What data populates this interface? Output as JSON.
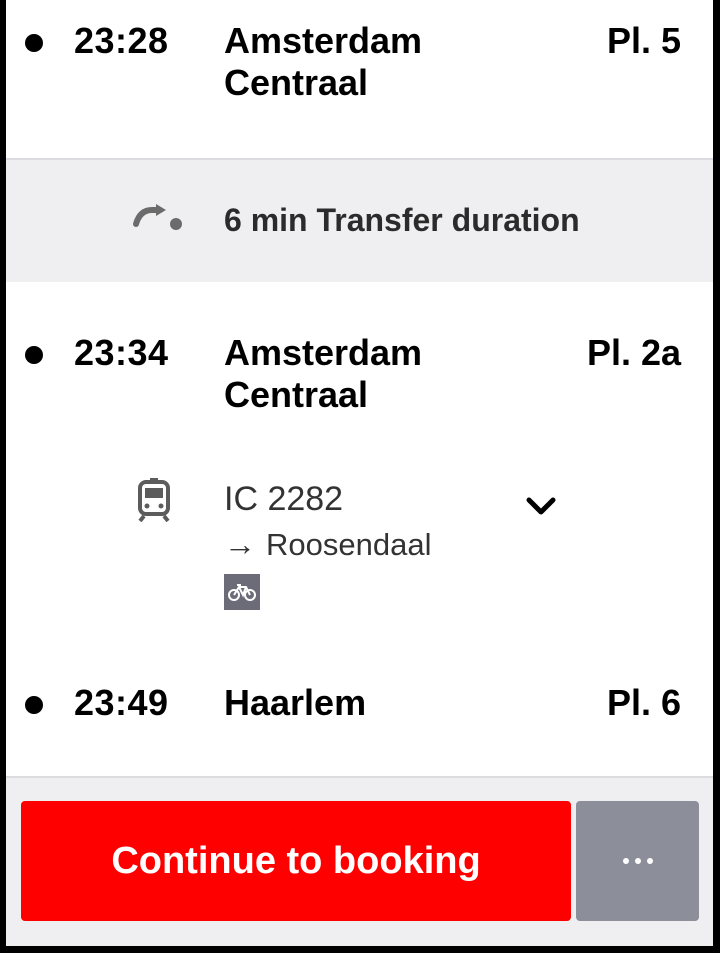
{
  "stops": [
    {
      "time": "23:28",
      "station": "Amsterdam Centraal",
      "platform": "Pl. 5"
    },
    {
      "time": "23:34",
      "station": "Amsterdam Centraal",
      "platform": "Pl. 2a"
    },
    {
      "time": "23:49",
      "station": "Haarlem",
      "platform": "Pl. 6"
    }
  ],
  "transfer": {
    "text": "6 min Transfer duration",
    "icon": "transfer-walk-icon"
  },
  "leg": {
    "train": "IC 2282",
    "direction": "Roosendaal",
    "icons": [
      "train-icon",
      "arrow-right-icon",
      "bicycle-icon",
      "chevron-down-icon"
    ]
  },
  "footer": {
    "continue_label": "Continue to booking",
    "more_icon": "more-options-icon"
  },
  "colors": {
    "primary_button": "#ff0000",
    "secondary_button": "#8c8f99",
    "transfer_background": "#efeff1"
  }
}
